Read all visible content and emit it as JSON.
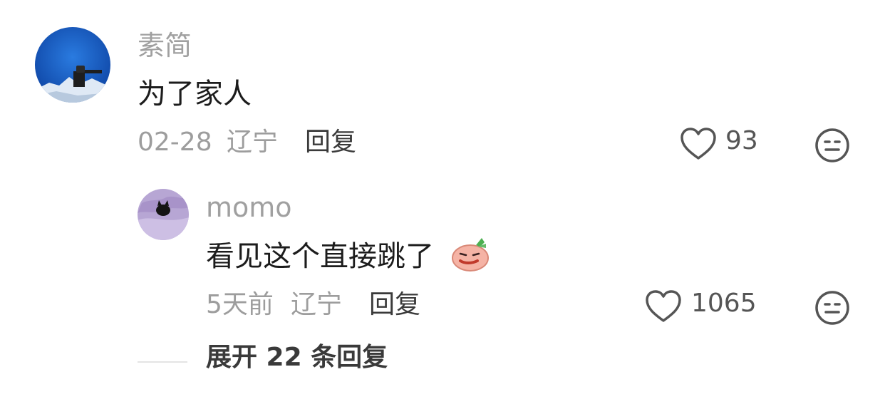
{
  "comments": [
    {
      "username": "素简",
      "text": "为了家人",
      "date": "02-28",
      "location": "辽宁",
      "reply_label": "回复",
      "likes": "93"
    },
    {
      "username": "momo",
      "text": "看见这个直接跳了",
      "emoji": "radish-face-emoji",
      "date": "5天前",
      "location": "辽宁",
      "reply_label": "回复",
      "likes": "1065"
    }
  ],
  "expand_replies_label": "展开 22 条回复",
  "icons": {
    "like": "heart-outline-icon",
    "dislike": "neutral-face-icon"
  },
  "colors": {
    "username": "#a0a0a0",
    "text": "#1c1c1c",
    "meta": "#9d9d9d"
  }
}
